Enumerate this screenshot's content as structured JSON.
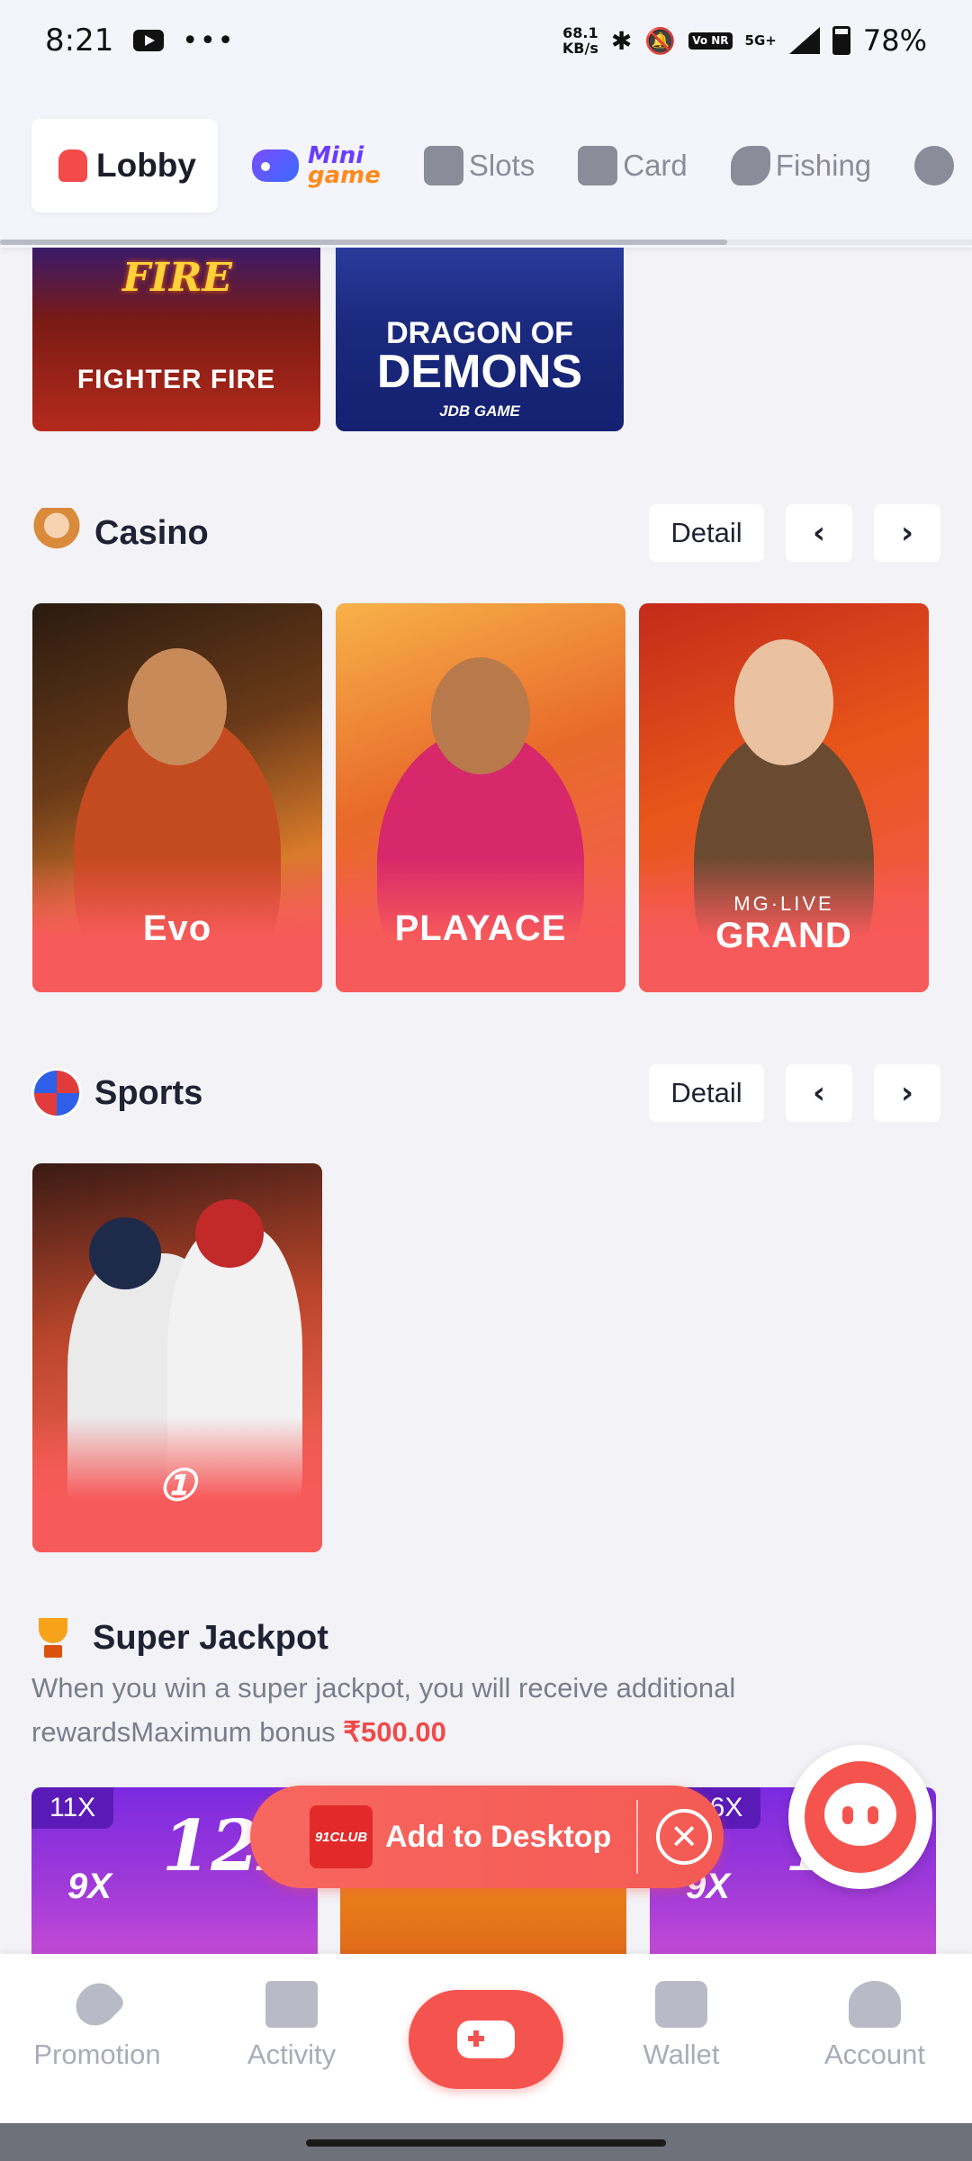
{
  "status_bar": {
    "time": "8:21",
    "more": "•••",
    "net_speed_value": "68.1",
    "net_speed_unit": "KB/s",
    "volte": "Vo NR",
    "network": "5G+",
    "battery": "78%"
  },
  "categories": {
    "lobby": "Lobby",
    "mini_line1": "Mini",
    "mini_line2": "game",
    "slots": "Slots",
    "card": "Card",
    "fishing": "Fishing"
  },
  "top_games": {
    "fighter_logo": "FIRE",
    "fighter_name": "FIGHTER FIRE",
    "dragon_line1": "DRAGON OF",
    "dragon_line2": "DEMONS",
    "dragon_provider": "JDB GAME"
  },
  "casino": {
    "title": "Casino",
    "detail": "Detail",
    "prev": "‹",
    "next": "›",
    "providers": [
      "Evo",
      "PLAYACE",
      "MG·LIVE",
      "GRAND"
    ]
  },
  "sports": {
    "title": "Sports",
    "detail": "Detail",
    "prev": "‹",
    "next": "›"
  },
  "jackpot": {
    "title": "Super Jackpot",
    "desc": "When you win a super jackpot, you will receive additional rewardsMaximum bonus ",
    "amount": "₹500.00",
    "cards": [
      {
        "tag": "11X",
        "big": "12X",
        "small": "9X"
      },
      {
        "tag": "66X",
        "big": "1",
        "small": "9X"
      }
    ]
  },
  "add_desktop": {
    "logo": "91CLUB",
    "label": "Add to Desktop",
    "close": "✕"
  },
  "bottom_nav": {
    "promotion": "Promotion",
    "activity": "Activity",
    "wallet": "Wallet",
    "account": "Account"
  }
}
